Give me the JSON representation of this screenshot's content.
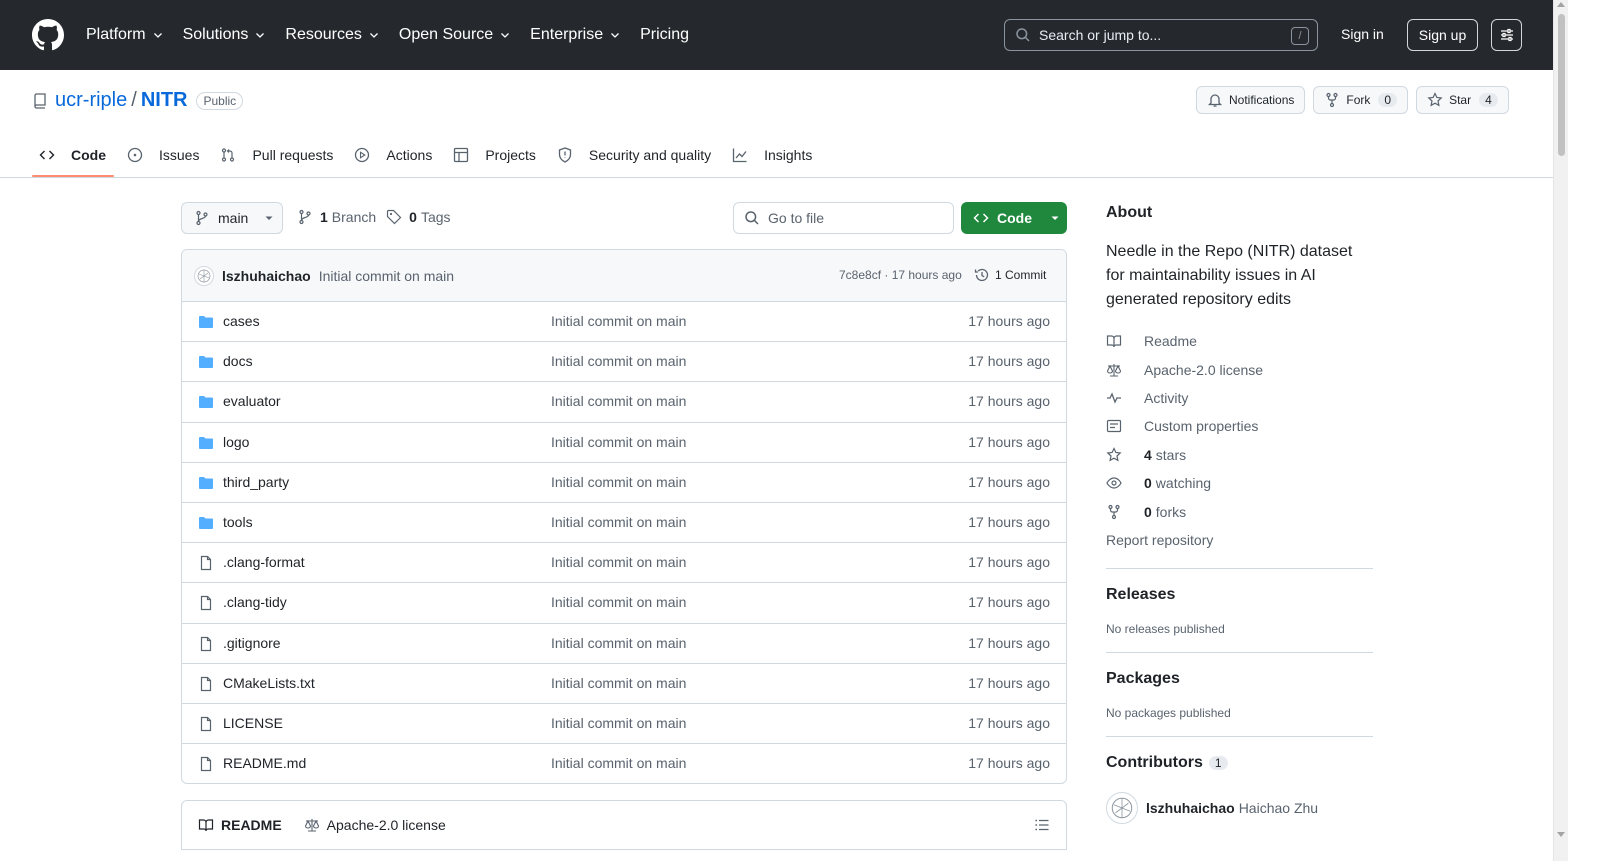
{
  "header": {
    "nav": [
      "Platform",
      "Solutions",
      "Resources",
      "Open Source",
      "Enterprise"
    ],
    "pricing": "Pricing",
    "search_placeholder": "Search or jump to...",
    "search_shortcut": "/",
    "signin": "Sign in",
    "signup": "Sign up"
  },
  "repo": {
    "owner": "ucr-riple",
    "separator": "/",
    "name": "NITR",
    "visibility": "Public",
    "notifications_label": "Notifications",
    "fork_label": "Fork",
    "fork_count": "0",
    "star_label": "Star",
    "star_count": "4"
  },
  "tabs": [
    "Code",
    "Issues",
    "Pull requests",
    "Actions",
    "Projects",
    "Security and quality",
    "Insights"
  ],
  "branch": {
    "current": "main",
    "branch_count": "1",
    "branch_label": "Branch",
    "tag_count": "0",
    "tag_label": "Tags",
    "goto_placeholder": "Go to file",
    "code_button": "Code"
  },
  "latest_commit": {
    "author": "lszhuhaichao",
    "message": "Initial commit on main",
    "meta": "7c8e8cf · 17 hours ago",
    "count_label": "1 Commit"
  },
  "files": [
    {
      "name": "cases",
      "type": "dir",
      "message": "Initial commit on main",
      "age": "17 hours ago"
    },
    {
      "name": "docs",
      "type": "dir",
      "message": "Initial commit on main",
      "age": "17 hours ago"
    },
    {
      "name": "evaluator",
      "type": "dir",
      "message": "Initial commit on main",
      "age": "17 hours ago"
    },
    {
      "name": "logo",
      "type": "dir",
      "message": "Initial commit on main",
      "age": "17 hours ago"
    },
    {
      "name": "third_party",
      "type": "dir",
      "message": "Initial commit on main",
      "age": "17 hours ago"
    },
    {
      "name": "tools",
      "type": "dir",
      "message": "Initial commit on main",
      "age": "17 hours ago"
    },
    {
      "name": ".clang-format",
      "type": "file",
      "message": "Initial commit on main",
      "age": "17 hours ago"
    },
    {
      "name": ".clang-tidy",
      "type": "file",
      "message": "Initial commit on main",
      "age": "17 hours ago"
    },
    {
      "name": ".gitignore",
      "type": "file",
      "message": "Initial commit on main",
      "age": "17 hours ago"
    },
    {
      "name": "CMakeLists.txt",
      "type": "file",
      "message": "Initial commit on main",
      "age": "17 hours ago"
    },
    {
      "name": "LICENSE",
      "type": "file",
      "message": "Initial commit on main",
      "age": "17 hours ago"
    },
    {
      "name": "README.md",
      "type": "file",
      "message": "Initial commit on main",
      "age": "17 hours ago"
    }
  ],
  "readme_tabs": [
    "README",
    "Apache-2.0 license"
  ],
  "sidebar": {
    "about_title": "About",
    "description": "Needle in the Repo (NITR) dataset for maintainability issues in AI generated repository edits",
    "readme": "Readme",
    "license": "Apache-2.0 license",
    "activity": "Activity",
    "custom_properties": "Custom properties",
    "stars_count": "4",
    "stars_label": "stars",
    "watching_count": "0",
    "watching_label": "watching",
    "forks_count": "0",
    "forks_label": "forks",
    "report": "Report repository",
    "releases_title": "Releases",
    "releases_text": "No releases published",
    "packages_title": "Packages",
    "packages_text": "No packages published",
    "contributors_title": "Contributors",
    "contributors_count": "1",
    "contributor_login": "lszhuhaichao",
    "contributor_name": "Haichao Zhu"
  },
  "colors": {
    "header_bg": "#25292e",
    "link": "#0969da",
    "primary_button": "#1f883d",
    "folder_icon": "#54aeff",
    "tab_underline": "#fd8c73"
  }
}
